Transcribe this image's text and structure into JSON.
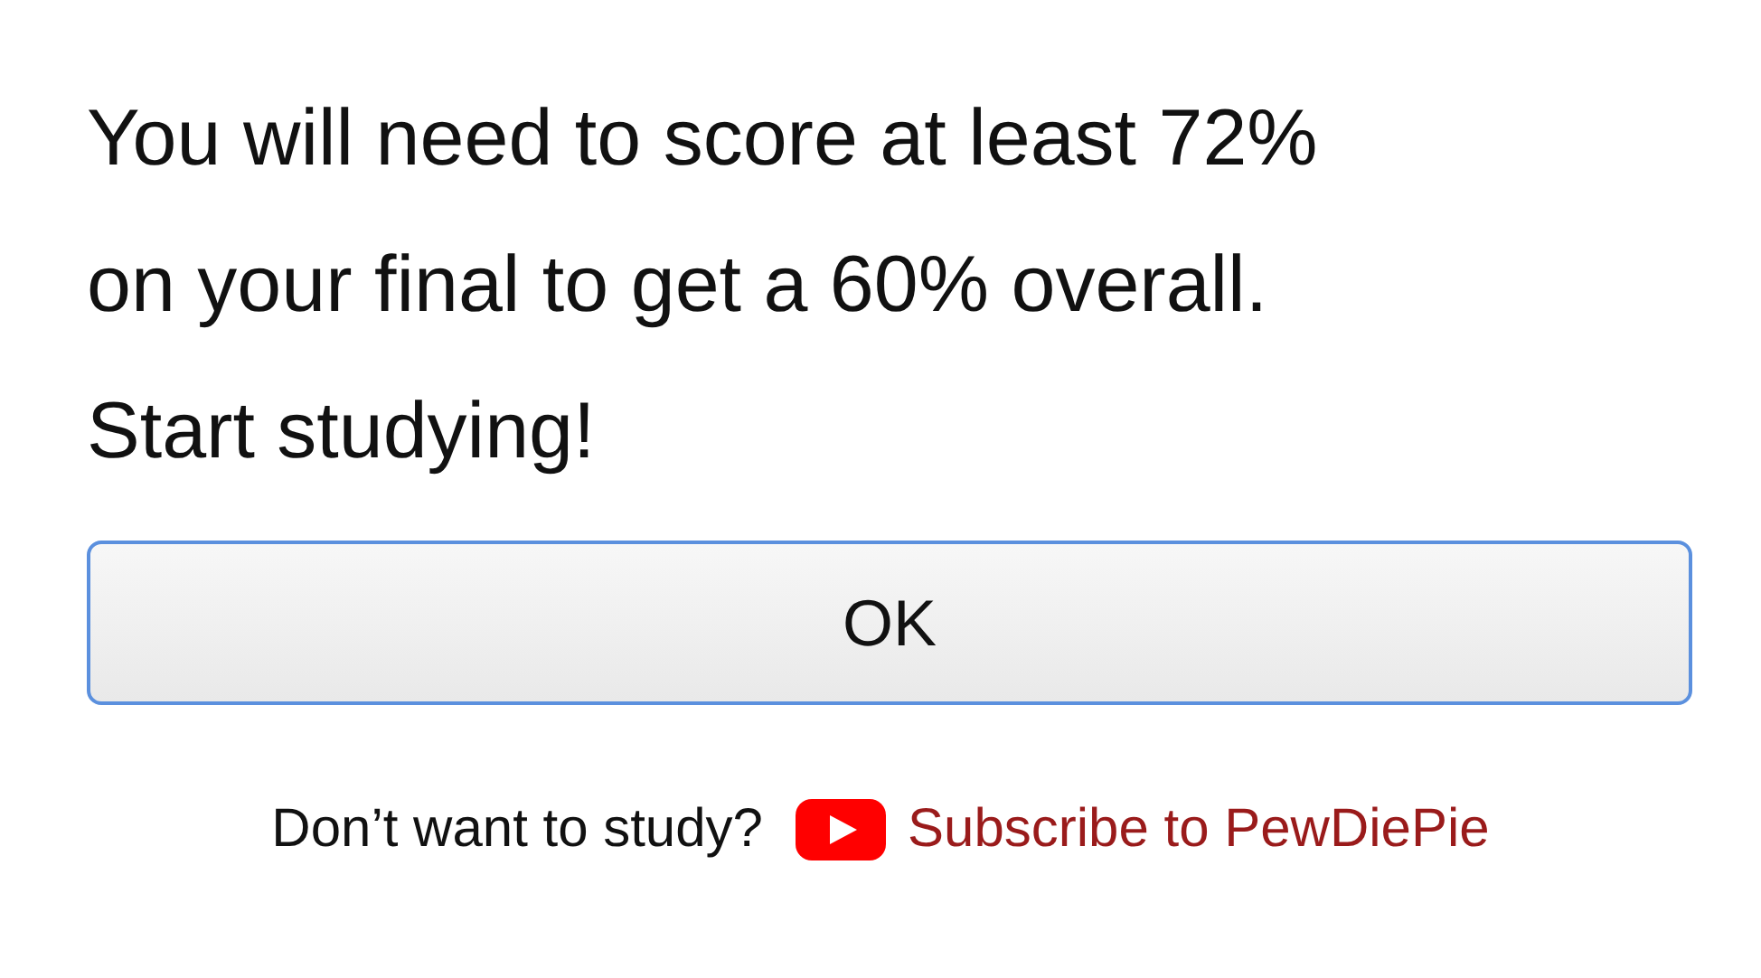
{
  "message": {
    "lines": [
      "You will need to score at least 72%",
      "on your final to get a 60% overall.",
      "Start studying!"
    ]
  },
  "button": {
    "label": "OK"
  },
  "footer": {
    "prompt": "Don’t want to study?",
    "link": "Subscribe to PewDiePie"
  }
}
